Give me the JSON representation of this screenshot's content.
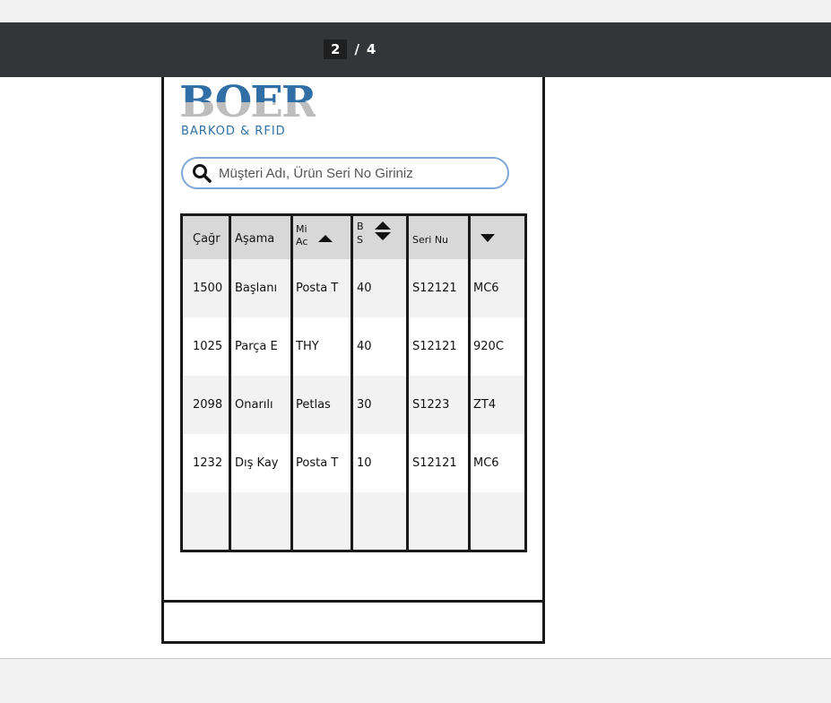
{
  "viewer": {
    "current_page": "2",
    "separator": "/",
    "total_pages": "4"
  },
  "logo": {
    "word": "BOER",
    "subtitle": "BARKOD & RFID"
  },
  "search": {
    "placeholder": "Müşteri Adı, Ürün Seri No Giriniz"
  },
  "table": {
    "headers": [
      "Çağr",
      "Aşama",
      "Mi Ac",
      "B S",
      "Seri Nu",
      ""
    ],
    "rows": [
      [
        "1500",
        "Başlanı",
        "Posta T",
        "40",
        "S12121",
        "MC6"
      ],
      [
        "1025",
        "Parça E",
        "THY",
        "40",
        "S12121",
        "920C"
      ],
      [
        "2098",
        "Onarılı",
        "Petlas",
        "30",
        "S1223",
        "ZT4"
      ],
      [
        "1232",
        "Dış Kay",
        "Posta T",
        "10",
        "S12121",
        "MC6"
      ]
    ]
  }
}
